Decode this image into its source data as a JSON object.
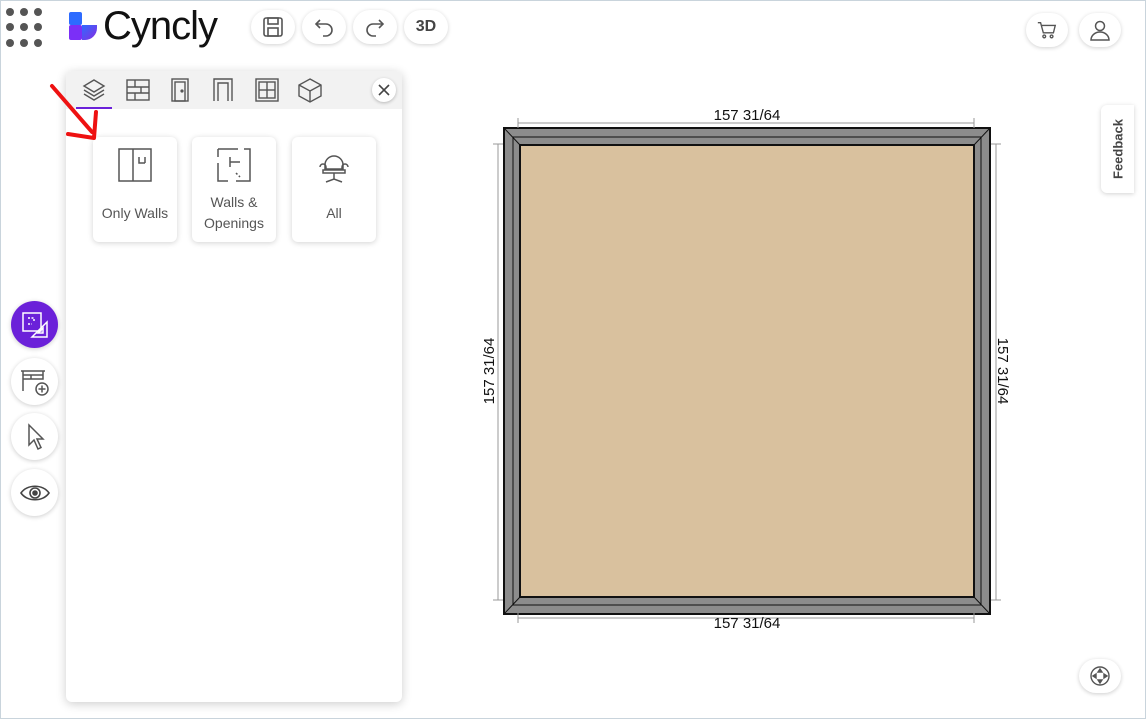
{
  "app": {
    "logo_text": "Cyncly",
    "brand_color": "#6b21d9"
  },
  "toolbar": {
    "save_icon": "save-icon",
    "undo_icon": "undo-icon",
    "redo_icon": "redo-icon",
    "view3d_label": "3D"
  },
  "header_right": {
    "cart_icon": "cart-icon",
    "user_icon": "user-icon"
  },
  "panel": {
    "tabs": [
      "layers-icon",
      "wall-brick-icon",
      "door-icon",
      "opening-icon",
      "window-icon",
      "box-icon"
    ],
    "active_tab": 0,
    "cards": [
      {
        "label": "Only Walls",
        "icon": "only-walls-icon"
      },
      {
        "label_line1": "Walls &",
        "label_line2": "Openings",
        "icon": "walls-openings-icon"
      },
      {
        "label": "All",
        "icon": "chair-icon"
      }
    ]
  },
  "left_tools": [
    "floorplan-tool-icon",
    "add-furniture-icon",
    "pointer-icon",
    "eye-icon"
  ],
  "feedback": {
    "label": "Feedback"
  },
  "floorplan": {
    "top_dim": "157 31/64",
    "bottom_dim": "157 31/64",
    "left_dim": "157 31/64",
    "right_dim": "157 31/64",
    "floor_color": "#d9c19e",
    "wall_color": "#8c8c8c"
  }
}
